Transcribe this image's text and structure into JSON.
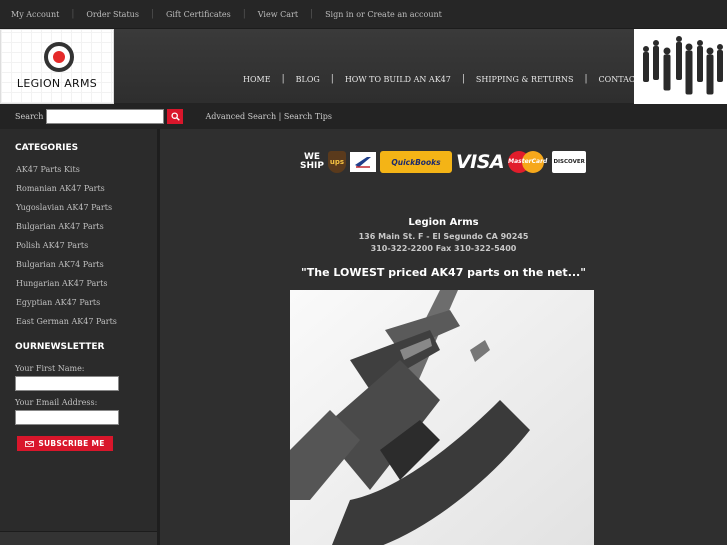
{
  "topbar": {
    "links": [
      "My Account",
      "Order Status",
      "Gift Certificates",
      "View Cart",
      "Sign in or Create an account"
    ]
  },
  "logo": {
    "text": "LEGION ARMS"
  },
  "nav": {
    "items": [
      "HOME",
      "BLOG",
      "HOW TO BUILD AN AK47",
      "SHIPPING & RETURNS",
      "CONTACT US"
    ],
    "separator": "|"
  },
  "search": {
    "label": "Search",
    "value": "",
    "advanced_link": "Advanced Search | Search Tips"
  },
  "sidebar": {
    "categories_heading": "CATEGORIES",
    "categories": [
      "AK47 Parts Kits",
      "Romanian AK47 Parts",
      "Yugoslavian AK47 Parts",
      "Bulgarian AK47 Parts",
      "Polish AK47 Parts",
      "Bulgarian AK74 Parts",
      "Hungarian AK47 Parts",
      "Egyptian AK47 Parts",
      "East German AK47 Parts"
    ],
    "newsletter_heading": "OURNEWSLETTER",
    "first_name_label": "Your First Name:",
    "email_label": "Your Email Address:",
    "subscribe_label": "SUBSCRIBE ME"
  },
  "banner": {
    "we_ship": [
      "WE",
      "SHIP"
    ],
    "ups": "ups",
    "quickbooks": "QuickBooks",
    "visa": "VISA",
    "mastercard": "MasterCard",
    "discover": "DISCOVER"
  },
  "store": {
    "name": "Legion Arms",
    "address": "136 Main St. F - El Segundo CA 90245",
    "phones": "310-322-2200 Fax 310-322-5400",
    "tagline": "\"The LOWEST priced  AK47 parts on the net...\""
  },
  "colors": {
    "accent": "#d9162b",
    "background": "#2b2b2b"
  }
}
